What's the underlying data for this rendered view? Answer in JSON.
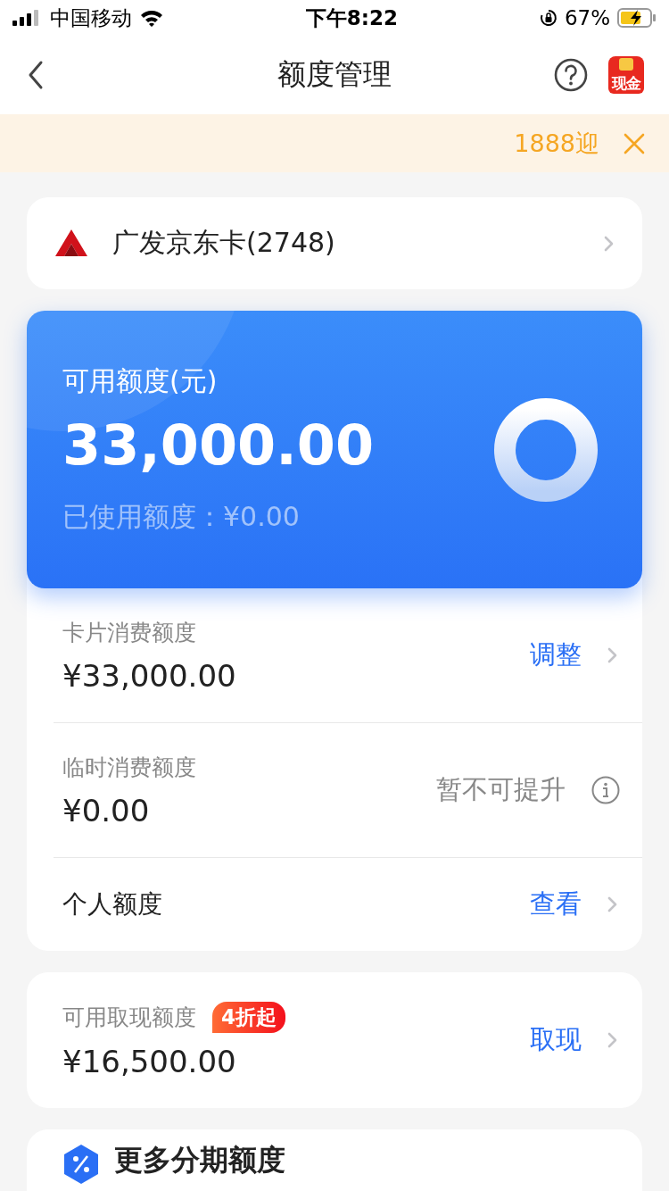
{
  "status_bar": {
    "carrier": "中国移动",
    "time": "下午8:22",
    "battery": "67%"
  },
  "nav": {
    "title": "额度管理",
    "badge": "现金"
  },
  "notice": {
    "text": "1888迎"
  },
  "card_selector": {
    "label": "广发京东卡(2748)"
  },
  "available": {
    "label": "可用额度(元)",
    "amount": "33,000.00",
    "used": "已使用额度：¥0.00"
  },
  "limits": [
    {
      "kind": "action",
      "label": "卡片消费额度",
      "amount": "¥33,000.00",
      "action": "调整"
    },
    {
      "kind": "info",
      "label": "临时消费额度",
      "amount": "¥0.00",
      "status": "暂不可提升"
    },
    {
      "kind": "action",
      "label": "个人额度",
      "action": "查看"
    }
  ],
  "cash": {
    "label": "可用取现额度",
    "tag": "4折起",
    "amount": "¥16,500.00",
    "action": "取现"
  },
  "more": {
    "title": "更多分期额度"
  }
}
